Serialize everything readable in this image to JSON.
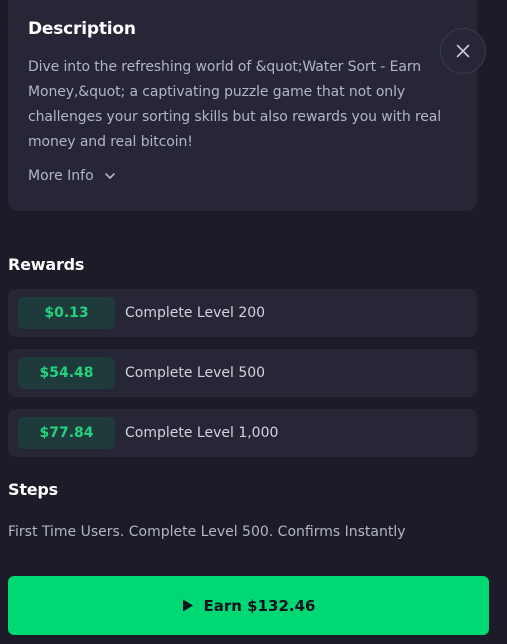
{
  "description": {
    "title": "Description",
    "text": "Dive into the refreshing world of &quot;Water Sort - Earn Money,&quot; a captivating puzzle game that not only challenges your sorting skills but also rewards you with real money and real bitcoin!",
    "more_info_label": "More Info"
  },
  "rewards": {
    "title": "Rewards",
    "items": [
      {
        "amount": "$0.13",
        "label": "Complete Level 200"
      },
      {
        "amount": "$54.48",
        "label": "Complete Level 500"
      },
      {
        "amount": "$77.84",
        "label": "Complete Level 1,000"
      }
    ]
  },
  "steps": {
    "title": "Steps",
    "text": "First Time Users. Complete Level 500. Confirms Instantly"
  },
  "earn_button": {
    "label": "Earn $132.46",
    "icon": "play-icon"
  },
  "close_button": {
    "icon": "close-icon"
  },
  "colors": {
    "background": "#1c1c29",
    "card": "#262637",
    "accent_green": "#00d874",
    "amount_green": "#22d37d"
  }
}
